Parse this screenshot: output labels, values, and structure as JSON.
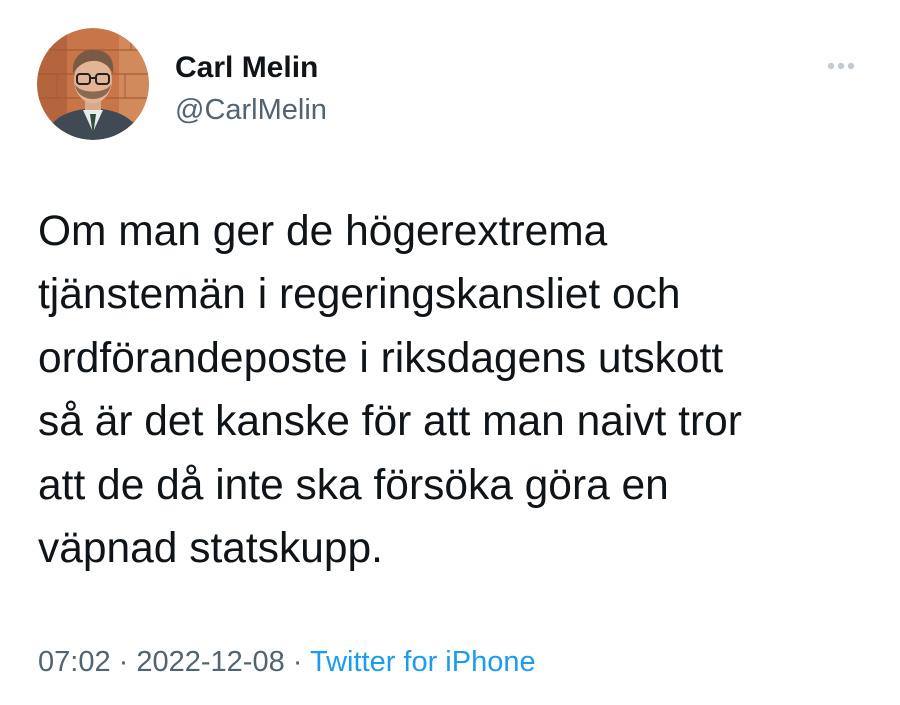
{
  "author": {
    "name": "Carl Melin",
    "handle": "@CarlMelin"
  },
  "more_icon": "more-horizontal-icon",
  "tweet": {
    "text": "Om man ger de högerextrema\ntjänstemän i regeringskansliet och\nordförandeposte i riksdagens utskott\nså är det kanske för att man naivt tror\natt de då inte ska försöka göra en\nväpnad statskupp."
  },
  "meta": {
    "time": "07:02",
    "separator": " · ",
    "date": "2022-12-08",
    "source": "Twitter for iPhone"
  },
  "colors": {
    "text": "#0f1419",
    "secondary": "#536471",
    "link": "#1d9bf0"
  }
}
